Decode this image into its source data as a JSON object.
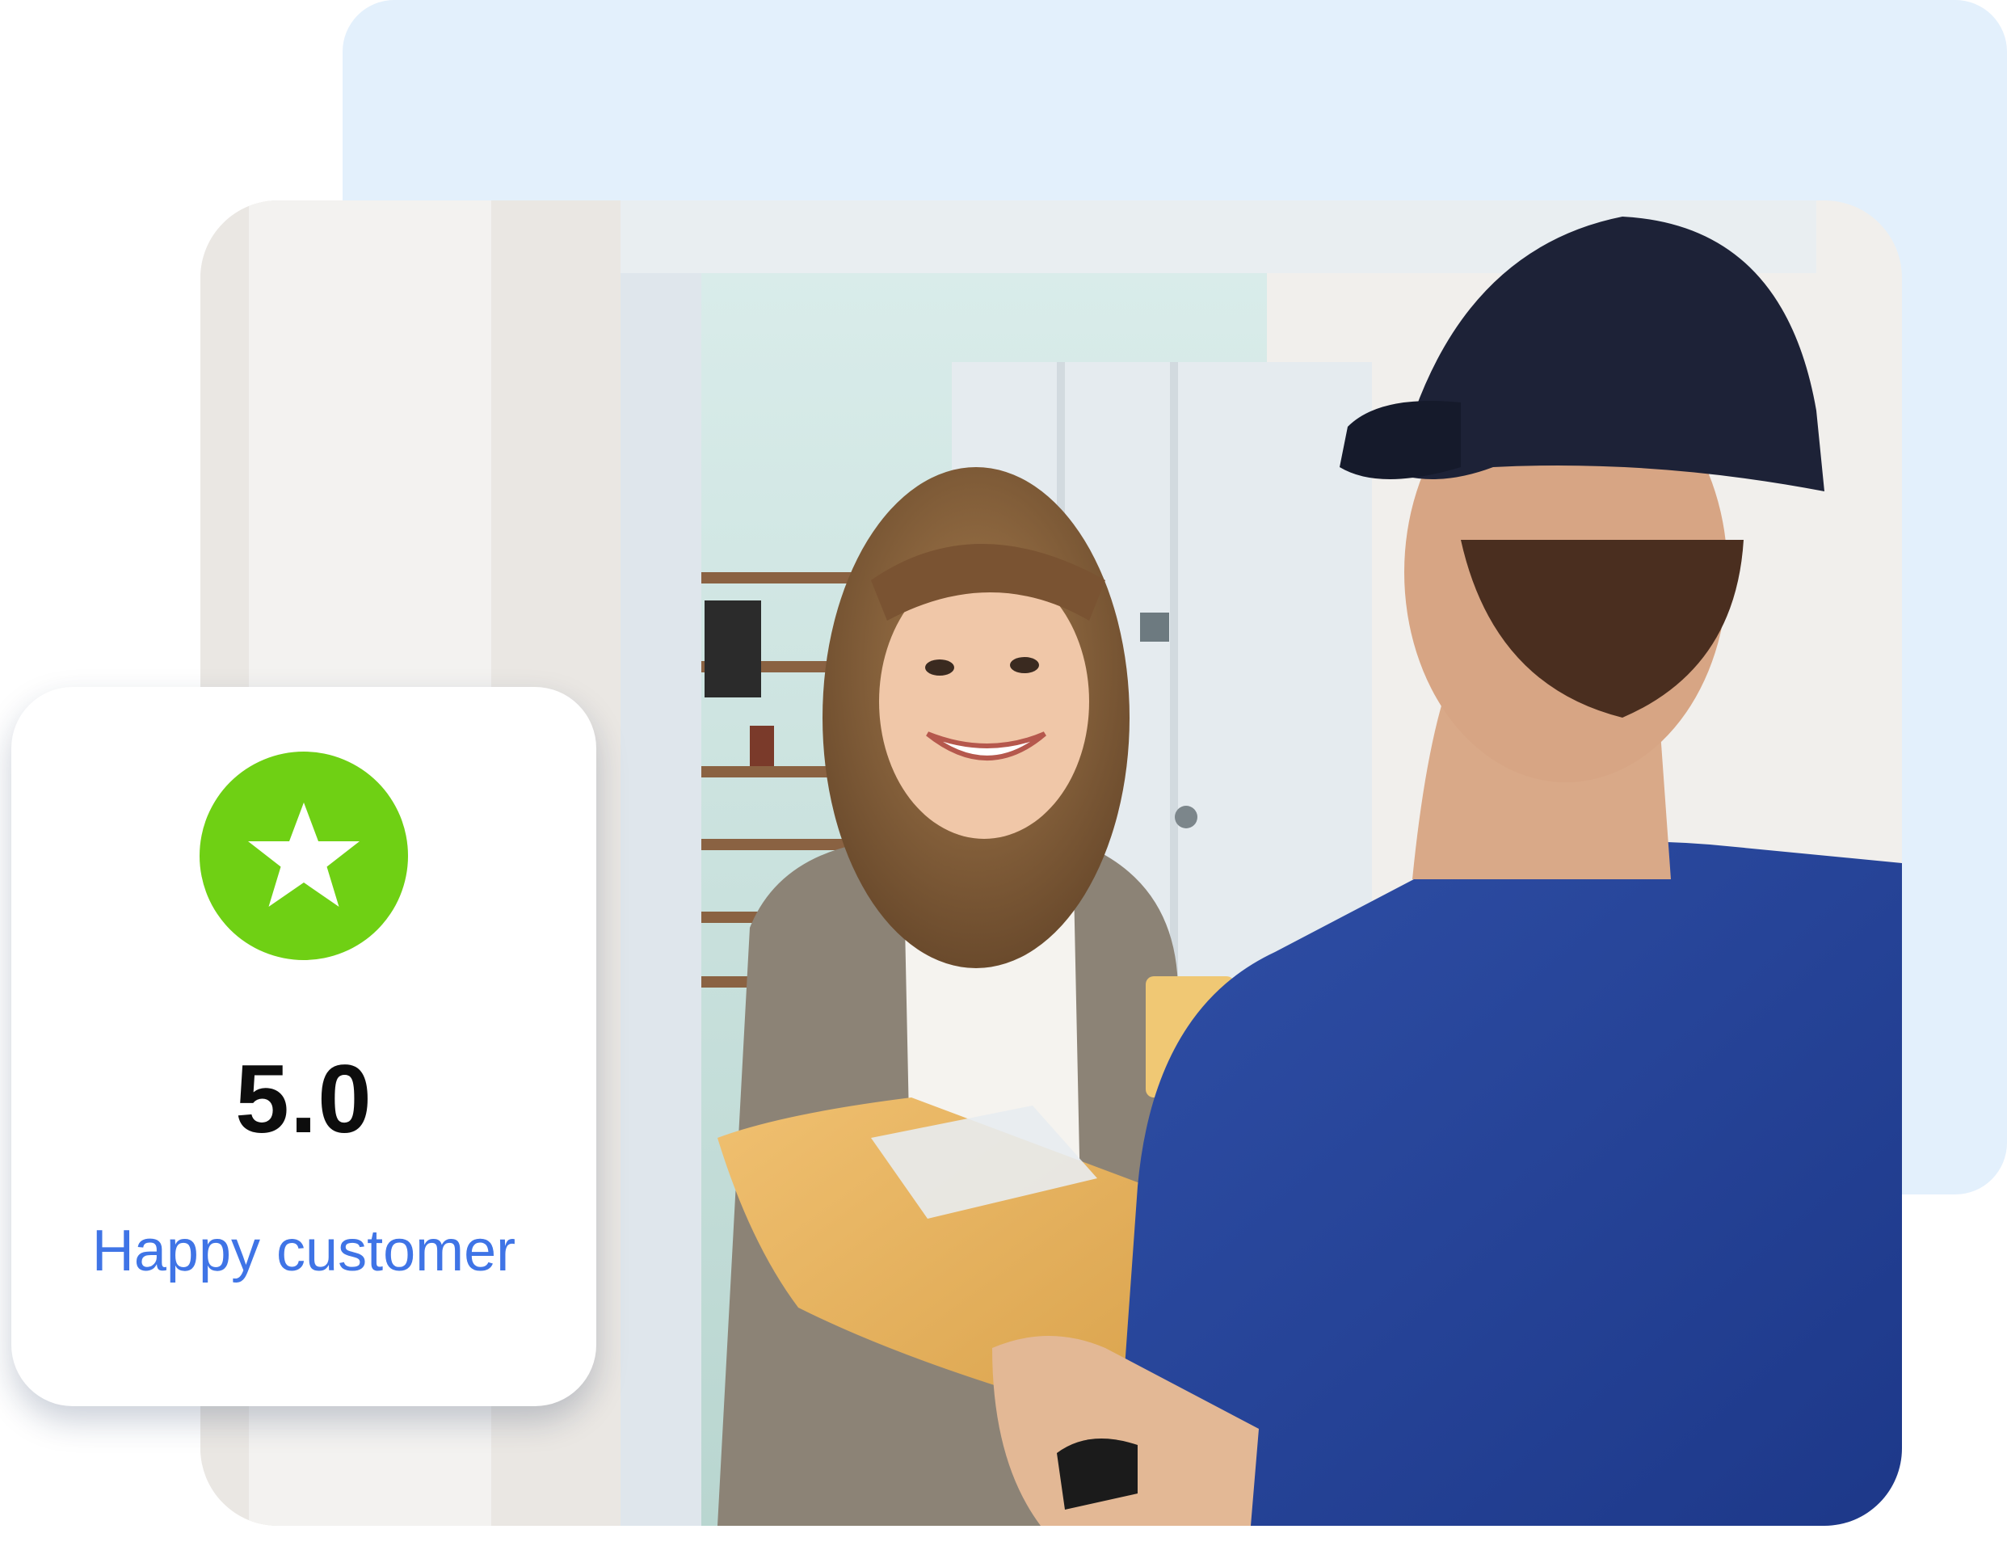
{
  "colors": {
    "backdrop": "#e3f0fc",
    "star_badge": "#6fd014",
    "label_text": "#3f74e6",
    "value_text": "#0d0d0d"
  },
  "photo": {
    "icon": "delivery-photo",
    "scene": "courier-handing-package"
  },
  "rating": {
    "icon": "star-icon",
    "value": "5.0",
    "label": "Happy customer"
  }
}
